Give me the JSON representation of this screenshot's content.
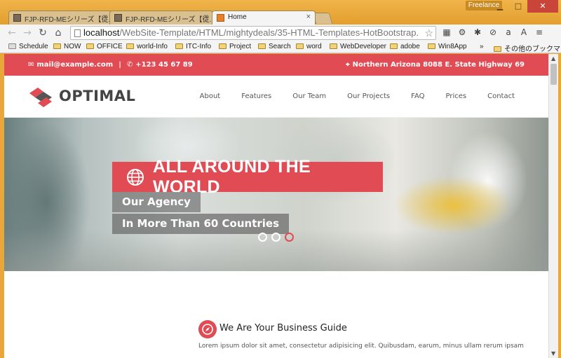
{
  "window": {
    "profile_label": "Freelance",
    "minimize": "▁",
    "maximize": "□",
    "close": "✕"
  },
  "tabs": [
    {
      "label": "FJP-RFD-MEシリーズ【従...",
      "close": "×"
    },
    {
      "label": "FJP-RFD-MEシリーズ【従...",
      "close": "×"
    },
    {
      "label": "Home",
      "close": "×"
    }
  ],
  "toolbar": {
    "back": "←",
    "forward": "→",
    "reload": "↻",
    "home": "⌂",
    "url_host": "localhost",
    "url_path": "/WebSite-Template/HTML/mightydeals/35-HTML-Templates-HotBootstrap.",
    "star": "☆",
    "menu": "≡"
  },
  "bookmarks": {
    "items": [
      "Schedule",
      "NOW",
      "OFFICE",
      "world-Info",
      "ITC-Info",
      "Project",
      "Search",
      "word",
      "WebDeveloper",
      "adobe",
      "Win8App"
    ],
    "more": "»",
    "other": "その他のブックマーク"
  },
  "site": {
    "email": "mail@example.com",
    "separator": "|",
    "phone": "+123 45 67 89",
    "address": "Northern Arizona 8088 E. State Highway 69",
    "logo": "OPTIMAL",
    "nav": [
      "About",
      "Features",
      "Our Team",
      "Our Projects",
      "FAQ",
      "Prices",
      "Contact"
    ],
    "hero": {
      "title": "ALL AROUND THE WORLD",
      "line1": "Our Agency",
      "line2": "In More Than 60 Countries",
      "slides": 3,
      "active_slide": 3
    },
    "section": {
      "title": "We Are Your Business Guide",
      "body": "Lorem ipsum dolor sit amet, consectetur adipisicing elit. Quibusdam, earum, minus ullam rerum ipsam"
    }
  },
  "colors": {
    "accent": "#e14b54",
    "chrome": "#e8a73a"
  }
}
